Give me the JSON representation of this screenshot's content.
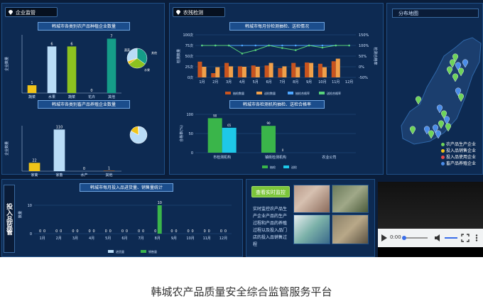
{
  "caption": "韩城农产品质量安全综合监管服务平台",
  "panels": {
    "enterprise_tab": "企业监管",
    "inspection_tab": "农残检测",
    "map_title": "分布地图",
    "inputs_tab": "投入品监管",
    "live_button": "查看实时监控",
    "live_desc": "实时监控农产品生产企业产品的生产过程和产品的养殖过程以及投入品门店的投入品销售过程"
  },
  "chart_data": [
    {
      "type": "bar",
      "title": "韩城市各类别农产品种植企业数量",
      "ylabel": "企业数量",
      "categories": [
        "蔬菜",
        "水果",
        "蔬菜",
        "花卉",
        "其他"
      ],
      "values": [
        1,
        6,
        6,
        0,
        7
      ],
      "data_labels": [
        "1",
        "6",
        "6",
        "0",
        "7"
      ],
      "colors": [
        "#f0c419",
        "#b9dcf7",
        "#8dc21f",
        "#1a9a8a",
        "#159d88"
      ],
      "pie_labels": [
        "其他",
        "蔬菜",
        "水果"
      ]
    },
    {
      "type": "bar",
      "title": "韩城市各类别畜产品养殖企业数量",
      "ylabel": "企业数量",
      "categories": [
        "家禽",
        "家畜",
        "水产",
        "其他"
      ],
      "values": [
        22,
        110,
        0,
        1
      ],
      "data_labels": [
        "22",
        "110",
        "0",
        "1"
      ],
      "colors": [
        "#f0c419",
        "#b9dcf7",
        "#8dc21f",
        "#ef8a2f"
      ]
    },
    {
      "type": "bar",
      "title": "韩城市每月份检测抽检、送检情况",
      "ylabel": "检测数量",
      "y2label": "检测合格率",
      "categories": [
        "1月",
        "2月",
        "3月",
        "4月",
        "5月",
        "6月",
        "7月",
        "8月",
        "9月",
        "10月",
        "11月",
        "12月"
      ],
      "y_ticks": [
        "0次",
        "25次",
        "50次",
        "75次",
        "100次"
      ],
      "y2_ticks": [
        "-50%",
        "0%",
        "50%",
        "100%",
        "150%"
      ],
      "series": [
        {
          "name": "抽检数量",
          "values": [
            37,
            10,
            34,
            26,
            28,
            28,
            22,
            34,
            35,
            32,
            38,
            0
          ],
          "color": "#c8541f"
        },
        {
          "name": "送检数量",
          "values": [
            25,
            24,
            26,
            25,
            25,
            34,
            26,
            24,
            34,
            24,
            44,
            0
          ],
          "color": "#f0a04a"
        },
        {
          "name": "抽检合格率",
          "values": [
            100,
            100,
            100,
            100,
            100,
            100,
            100,
            100,
            100,
            100,
            100,
            100
          ],
          "color": "#4da6ff"
        },
        {
          "name": "送检合格率",
          "values": [
            100,
            100,
            100,
            62,
            78,
            100,
            88,
            78,
            100,
            90,
            100,
            100
          ],
          "color": "#58d27a"
        }
      ]
    },
    {
      "type": "bar",
      "title": "韩城市各检测机构抽检、送检合格率",
      "ylabel": "合格率(%)",
      "categories": [
        "市检测机构",
        "镇街检测机构",
        "农业公司"
      ],
      "y_ticks": [
        "0",
        "50",
        "100"
      ],
      "series": [
        {
          "name": "抽检",
          "values": [
            90,
            70,
            0
          ],
          "color": "#3ab54a"
        },
        {
          "name": "送检",
          "values": [
            65,
            0,
            0
          ],
          "color": "#1ec8e8"
        }
      ],
      "data_labels": [
        [
          "90",
          "65"
        ],
        [
          "90",
          "0"
        ],
        [
          "",
          ""
        ]
      ]
    },
    {
      "type": "bar",
      "title": "韩城市每月投入品进货量、销售量统计",
      "ylabel": "数量",
      "categories": [
        "1月",
        "2月",
        "3月",
        "4月",
        "5月",
        "6月",
        "7月",
        "8月",
        "9月",
        "10月",
        "11月",
        "12月"
      ],
      "y_ticks": [
        "0",
        "10"
      ],
      "series": [
        {
          "name": "进货量",
          "values": [
            0,
            0,
            0,
            0,
            0,
            0,
            0,
            0,
            0,
            0,
            0,
            0
          ],
          "color": "#b9dcf7"
        },
        {
          "name": "销售量",
          "values": [
            0,
            0,
            0,
            0,
            0,
            0,
            0,
            10,
            0,
            0,
            0,
            0
          ],
          "color": "#3ab54a"
        }
      ]
    }
  ],
  "map_legend": [
    {
      "label": "农产品生产企业",
      "color": "#6ed35a"
    },
    {
      "label": "投入品销售企业",
      "color": "#f0c419"
    },
    {
      "label": "投入品使用企业",
      "color": "#e84a4a"
    },
    {
      "label": "畜产品养殖企业",
      "color": "#4a8ce8"
    }
  ],
  "video": {
    "time": "0:00"
  },
  "icons": [
    "map-pin-icon",
    "play-icon",
    "volume-icon",
    "fullscreen-icon",
    "more-icon"
  ]
}
